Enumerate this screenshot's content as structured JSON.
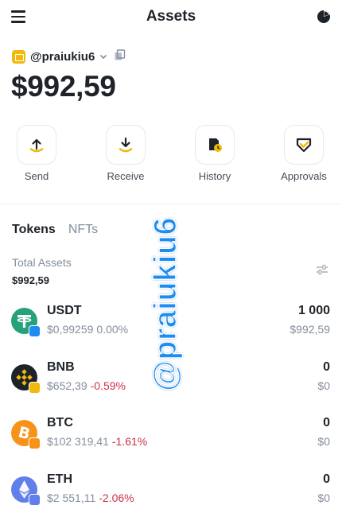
{
  "header": {
    "title": "Assets"
  },
  "account": {
    "name": "@praiukiu6"
  },
  "balance": {
    "value": "$992,59"
  },
  "actions": [
    {
      "label": "Send"
    },
    {
      "label": "Receive"
    },
    {
      "label": "History"
    },
    {
      "label": "Approvals"
    }
  ],
  "tabs": [
    {
      "label": "Tokens",
      "active": true
    },
    {
      "label": "NFTs",
      "active": false
    }
  ],
  "total": {
    "label": "Total Assets",
    "value": "$992,59"
  },
  "tokens": [
    {
      "symbol": "USDT",
      "price": "$0,99259",
      "change": "0.00%",
      "amount": "1 000",
      "fiat": "$992,59",
      "logo_color": "#26a17b",
      "badge_color": "#1e8cf0"
    },
    {
      "symbol": "BNB",
      "price": "$652,39",
      "change": "-0.59%",
      "amount": "0",
      "fiat": "$0",
      "logo_color": "#1e2329",
      "badge_color": "#f0b90b"
    },
    {
      "symbol": "BTC",
      "price": "$102 319,41",
      "change": "-1.61%",
      "amount": "0",
      "fiat": "$0",
      "logo_color": "#f7931a",
      "badge_color": "#f7931a"
    },
    {
      "symbol": "ETH",
      "price": "$2 551,11",
      "change": "-2.06%",
      "amount": "0",
      "fiat": "$0",
      "logo_color": "#627eea",
      "badge_color": "#627eea"
    }
  ],
  "watermark": {
    "text": "@praiukiu6"
  },
  "colors": {
    "accent": "#f0b90b",
    "negative": "#cf304a",
    "muted": "#848e9c",
    "text": "#1e2329"
  }
}
